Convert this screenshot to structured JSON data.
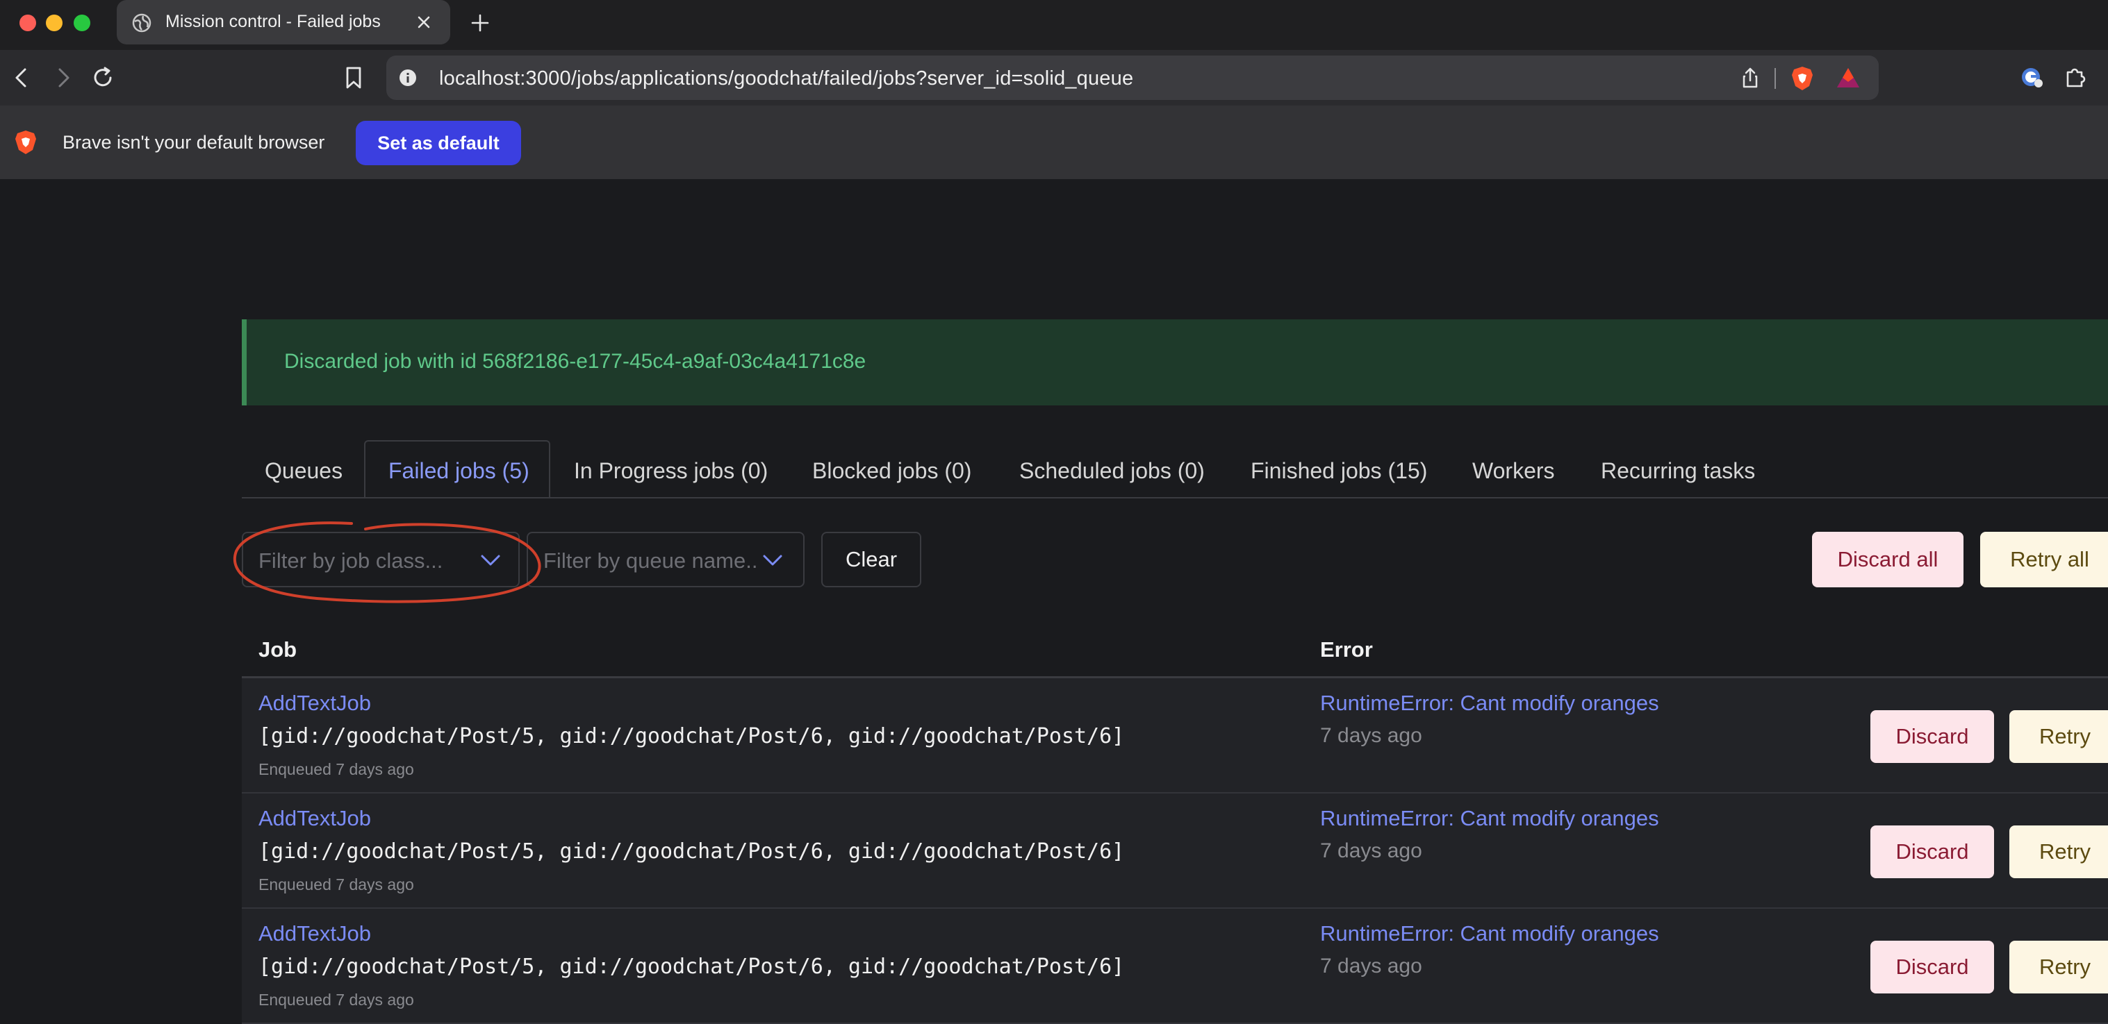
{
  "browser": {
    "tab_title": "Mission control - Failed jobs",
    "url": "localhost:3000/jobs/applications/goodchat/failed/jobs?server_id=solid_queue",
    "infobar_text": "Brave isn't your default browser",
    "infobar_button": "Set as default"
  },
  "flash": {
    "message": "Discarded job with id 568f2186-e177-45c4-a9af-03c4a4171c8e"
  },
  "tabs": [
    {
      "label": "Queues"
    },
    {
      "label": "Failed jobs (5)"
    },
    {
      "label": "In Progress jobs (0)"
    },
    {
      "label": "Blocked jobs (0)"
    },
    {
      "label": "Scheduled jobs (0)"
    },
    {
      "label": "Finished jobs (15)"
    },
    {
      "label": "Workers"
    },
    {
      "label": "Recurring tasks"
    }
  ],
  "filters": {
    "job_class_placeholder": "Filter by job class...",
    "queue_name_placeholder": "Filter by queue name...",
    "clear_label": "Clear",
    "discard_all_label": "Discard all",
    "retry_all_label": "Retry all"
  },
  "table": {
    "headers": {
      "job": "Job",
      "error": "Error"
    },
    "rows": [
      {
        "job": "AddTextJob",
        "args": "[gid://goodchat/Post/5, gid://goodchat/Post/6, gid://goodchat/Post/6]",
        "enqueued": "Enqueued 7 days ago",
        "error": "RuntimeError: Cant modify oranges",
        "failed_ago": "7 days ago",
        "discard_label": "Discard",
        "retry_label": "Retry"
      },
      {
        "job": "AddTextJob",
        "args": "[gid://goodchat/Post/5, gid://goodchat/Post/6, gid://goodchat/Post/6]",
        "enqueued": "Enqueued 7 days ago",
        "error": "RuntimeError: Cant modify oranges",
        "failed_ago": "7 days ago",
        "discard_label": "Discard",
        "retry_label": "Retry"
      },
      {
        "job": "AddTextJob",
        "args": "[gid://goodchat/Post/5, gid://goodchat/Post/6, gid://goodchat/Post/6]",
        "enqueued": "Enqueued 7 days ago",
        "error": "RuntimeError: Cant modify oranges",
        "failed_ago": "7 days ago",
        "discard_label": "Discard",
        "retry_label": "Retry"
      }
    ]
  },
  "colors": {
    "link": "#7b8cf5",
    "flash_text": "#5fc98a",
    "annotation": "#d0402b"
  }
}
